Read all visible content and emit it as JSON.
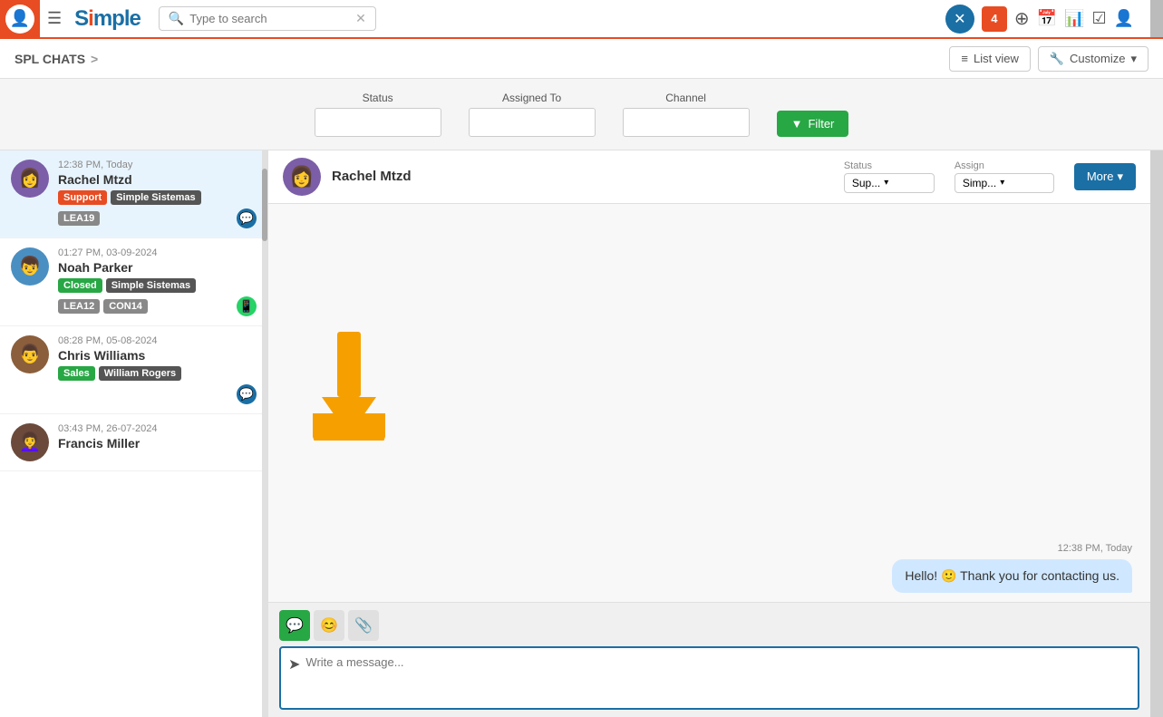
{
  "app": {
    "title": "Simple",
    "logo_text": "Simple"
  },
  "topnav": {
    "search_placeholder": "Type to search",
    "icons": [
      "✕",
      "4",
      "+",
      "📅",
      "📊",
      "☑",
      "👤"
    ]
  },
  "subheader": {
    "breadcrumb": "SPL CHATS",
    "breadcrumb_arrow": ">",
    "list_view_label": "List view",
    "customize_label": "Customize"
  },
  "filter": {
    "status_label": "Status",
    "assigned_to_label": "Assigned To",
    "channel_label": "Channel",
    "filter_button": "Filter"
  },
  "chat_list": {
    "items": [
      {
        "time": "12:38 PM, Today",
        "name": "Rachel Mtzd",
        "tags": [
          "Support",
          "Simple Sistemas",
          "LEA19"
        ],
        "channel": "blue",
        "avatar_color": "#7b5ea7"
      },
      {
        "time": "01:27 PM, 03-09-2024",
        "name": "Noah Parker",
        "tags": [
          "Closed",
          "Simple Sistemas",
          "LEA12",
          "CON14"
        ],
        "channel": "green",
        "avatar_color": "#4a8fc1"
      },
      {
        "time": "08:28 PM, 05-08-2024",
        "name": "Chris Williams",
        "tags": [
          "Sales",
          "William Rogers"
        ],
        "channel": "blue",
        "avatar_color": "#8b5e3c"
      },
      {
        "time": "03:43 PM, 26-07-2024",
        "name": "Francis Miller",
        "tags": [],
        "channel": "",
        "avatar_color": "#6b4a3c"
      }
    ]
  },
  "chat_window": {
    "contact_name": "Rachel Mtzd",
    "status_label": "Status",
    "status_value": "Sup...",
    "assign_label": "Assign",
    "assign_value": "Simp...",
    "more_button": "More",
    "message_time": "12:38 PM, Today",
    "message_text": "Hello! 🙂 Thank you for contacting us.",
    "compose_placeholder": "Write a message...",
    "avatar_color": "#7b5ea7"
  }
}
